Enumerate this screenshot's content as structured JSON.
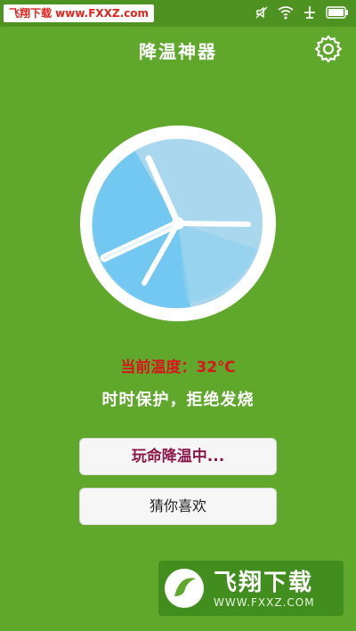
{
  "status_bar": {
    "watermark": "飞翔下载 www.FXXZ.com",
    "icons": [
      "mute-icon",
      "wifi-icon",
      "airplane-icon",
      "battery-icon"
    ]
  },
  "header": {
    "title": "降温神器",
    "settings_icon": "gear-icon"
  },
  "fan": {
    "icon": "fan-icon",
    "colors": {
      "ring": "#ffffff",
      "dial": "#a9d8ee",
      "sweep": "#6cc6ef",
      "blade": "#ffffff"
    }
  },
  "main": {
    "temperature_text": "当前温度：32℃",
    "slogan": "时时保护，拒绝发烧"
  },
  "buttons": {
    "cool_label": "玩命降温中...",
    "like_label": "猜你喜欢"
  },
  "watermark_bottom": {
    "title": "飞翔下载",
    "url": "WWW.FXXZ.COM"
  },
  "colors": {
    "background": "#5fa82c",
    "status_bar": "#4e9221",
    "temp_text": "#d9161c",
    "cool_button_text": "#8b1a4a"
  }
}
